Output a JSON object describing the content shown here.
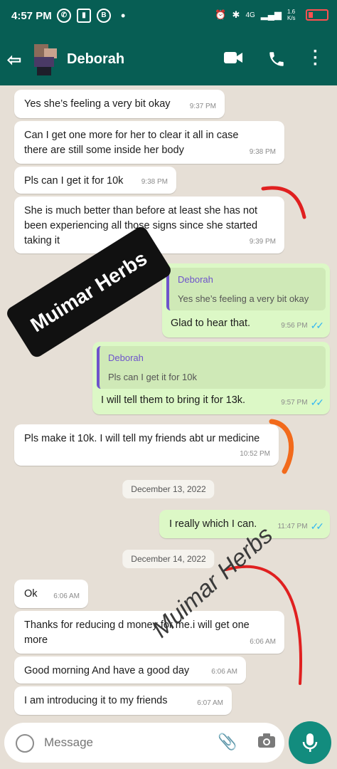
{
  "status": {
    "time": "4:57 PM",
    "signal_label": "4G",
    "speed_label": "1.6 K/s"
  },
  "header": {
    "contact_name": "Deborah"
  },
  "messages": [
    {
      "text": "Yes she’s feeling a very bit okay",
      "time": "9:37 PM"
    },
    {
      "text": "Can I get one more for her to clear it all in case there are still some inside her body",
      "time": "9:38 PM"
    },
    {
      "text": "Pls can I get it for 10k",
      "time": "9:38 PM"
    },
    {
      "text": "She is much better than before at least she has not been experiencing all those signs since she started taking it",
      "time": "9:39 PM"
    },
    {
      "reply_to_name": "Deborah",
      "reply_to_text": "Yes she’s feeling a very bit okay",
      "text": "Glad to hear that.",
      "time": "9:56 PM"
    },
    {
      "reply_to_name": "Deborah",
      "reply_to_text": "Pls can I get it for 10k",
      "text": "I will tell them to bring it for 13k.",
      "time": "9:57 PM"
    },
    {
      "text": "Pls make it 10k. I will tell my friends abt ur medicine",
      "time": "10:52 PM"
    },
    {
      "text": "I really which I can.",
      "time": "11:47 PM"
    },
    {
      "text": "Ok",
      "time": "6:06 AM"
    },
    {
      "text": "Thanks for reducing d money for me.i will get one more",
      "time": "6:06 AM"
    },
    {
      "text": "Good morning And have a good day",
      "time": "6:06 AM"
    },
    {
      "text": "I am introducing it to my friends",
      "time": "6:07 AM"
    }
  ],
  "dates": [
    "December 13, 2022",
    "December 14, 2022"
  ],
  "watermarks": [
    "Muimar Herbs",
    "Muimar Herbs"
  ],
  "input": {
    "placeholder": "Message"
  },
  "colors": {
    "header": "#075e54",
    "outgoing_bubble": "#dcf8c6",
    "incoming_bubble": "#ffffff",
    "read_ticks": "#34b7f1",
    "mic_button": "#128c7e",
    "annotation_red": "#e02020",
    "annotation_orange": "#f26a1b"
  }
}
